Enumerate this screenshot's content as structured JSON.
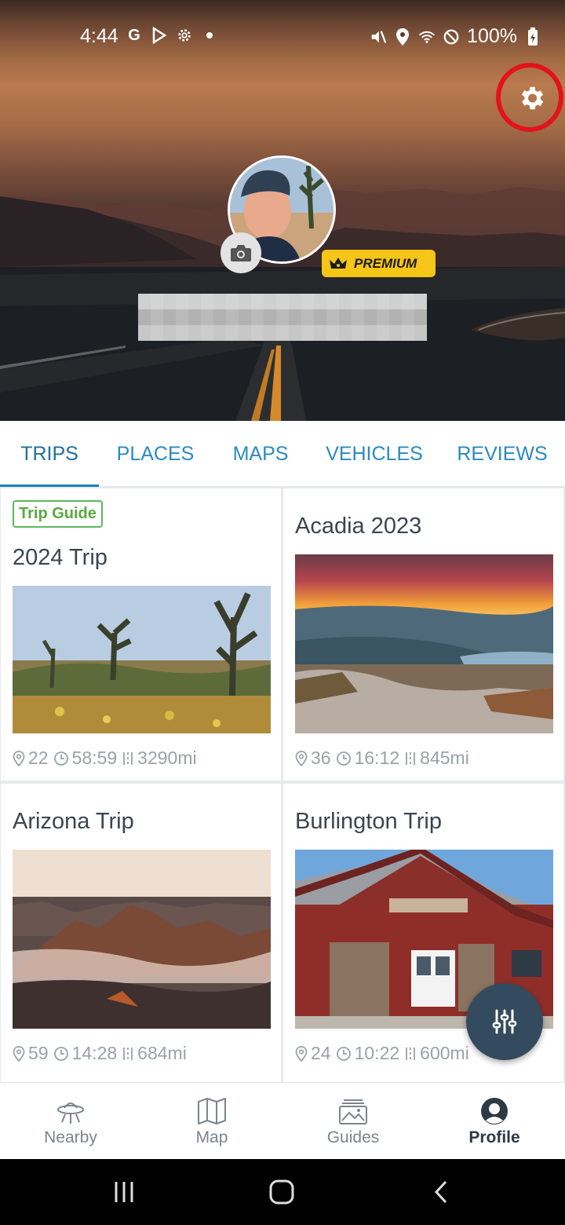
{
  "status_bar": {
    "time": "4:44",
    "left_icons": [
      "google-icon",
      "play-store-icon",
      "settings-gear-small-icon",
      "dot-icon"
    ],
    "right_icons": [
      "mute-icon",
      "location-icon",
      "wifi-icon",
      "do-not-disturb-icon"
    ],
    "battery": "100%"
  },
  "profile": {
    "badge_label": "PREMIUM",
    "username": "████████████"
  },
  "tabs": [
    {
      "label": "TRIPS",
      "active": true
    },
    {
      "label": "PLACES",
      "active": false
    },
    {
      "label": "MAPS",
      "active": false
    },
    {
      "label": "VEHICLES",
      "active": false
    },
    {
      "label": "REVIEWS",
      "active": false
    }
  ],
  "trips": [
    {
      "badge": "Trip Guide",
      "title": "2024 Trip",
      "stops": "22",
      "duration": "58:59",
      "distance": "3290mi"
    },
    {
      "badge": "",
      "title": "Acadia 2023",
      "stops": "36",
      "duration": "16:12",
      "distance": "845mi"
    },
    {
      "badge": "",
      "title": "Arizona Trip",
      "stops": "59",
      "duration": "14:28",
      "distance": "684mi"
    },
    {
      "badge": "",
      "title": "Burlington Trip",
      "stops": "24",
      "duration": "10:22",
      "distance": "600mi"
    }
  ],
  "bottom_nav": [
    {
      "label": "Nearby",
      "icon": "ufo-icon"
    },
    {
      "label": "Map",
      "icon": "map-icon"
    },
    {
      "label": "Guides",
      "icon": "guides-icon"
    },
    {
      "label": "Profile",
      "icon": "profile-icon",
      "active": true
    }
  ],
  "colors": {
    "accent": "#2a8ac1",
    "premium": "#f5c518",
    "trip_guide_green": "#5cb85c",
    "fab": "#344a5e",
    "highlight_ring": "#e3131b"
  }
}
